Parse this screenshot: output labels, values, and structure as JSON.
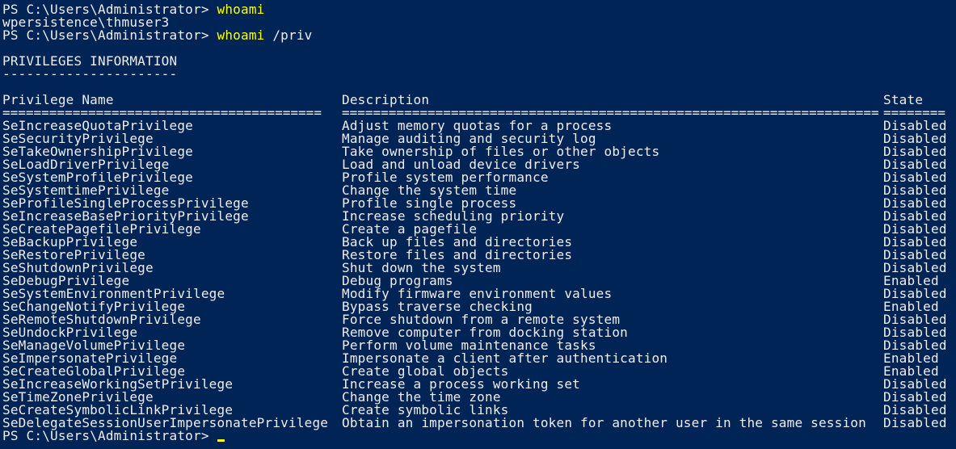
{
  "terminal": {
    "line1": {
      "prompt": "PS C:\\Users\\Administrator> ",
      "command": "whoami"
    },
    "output1": "wpersistence\\thmuser3",
    "line2": {
      "prompt": "PS C:\\Users\\Administrator> ",
      "command": "whoami",
      "args": " /priv"
    },
    "section_title": "PRIVILEGES INFORMATION",
    "section_underline": "----------------------",
    "headers": {
      "name": "Privilege Name",
      "description": "Description",
      "state": "State"
    },
    "separators": {
      "name": "=========================================",
      "description": "=====================================================================",
      "state": "========"
    },
    "rows": [
      {
        "name": "SeIncreaseQuotaPrivilege",
        "description": "Adjust memory quotas for a process",
        "state": "Disabled"
      },
      {
        "name": "SeSecurityPrivilege",
        "description": "Manage auditing and security log",
        "state": "Disabled"
      },
      {
        "name": "SeTakeOwnershipPrivilege",
        "description": "Take ownership of files or other objects",
        "state": "Disabled"
      },
      {
        "name": "SeLoadDriverPrivilege",
        "description": "Load and unload device drivers",
        "state": "Disabled"
      },
      {
        "name": "SeSystemProfilePrivilege",
        "description": "Profile system performance",
        "state": "Disabled"
      },
      {
        "name": "SeSystemtimePrivilege",
        "description": "Change the system time",
        "state": "Disabled"
      },
      {
        "name": "SeProfileSingleProcessPrivilege",
        "description": "Profile single process",
        "state": "Disabled"
      },
      {
        "name": "SeIncreaseBasePriorityPrivilege",
        "description": "Increase scheduling priority",
        "state": "Disabled"
      },
      {
        "name": "SeCreatePagefilePrivilege",
        "description": "Create a pagefile",
        "state": "Disabled"
      },
      {
        "name": "SeBackupPrivilege",
        "description": "Back up files and directories",
        "state": "Disabled"
      },
      {
        "name": "SeRestorePrivilege",
        "description": "Restore files and directories",
        "state": "Disabled"
      },
      {
        "name": "SeShutdownPrivilege",
        "description": "Shut down the system",
        "state": "Disabled"
      },
      {
        "name": "SeDebugPrivilege",
        "description": "Debug programs",
        "state": "Enabled"
      },
      {
        "name": "SeSystemEnvironmentPrivilege",
        "description": "Modify firmware environment values",
        "state": "Disabled"
      },
      {
        "name": "SeChangeNotifyPrivilege",
        "description": "Bypass traverse checking",
        "state": "Enabled"
      },
      {
        "name": "SeRemoteShutdownPrivilege",
        "description": "Force shutdown from a remote system",
        "state": "Disabled"
      },
      {
        "name": "SeUndockPrivilege",
        "description": "Remove computer from docking station",
        "state": "Disabled"
      },
      {
        "name": "SeManageVolumePrivilege",
        "description": "Perform volume maintenance tasks",
        "state": "Disabled"
      },
      {
        "name": "SeImpersonatePrivilege",
        "description": "Impersonate a client after authentication",
        "state": "Enabled"
      },
      {
        "name": "SeCreateGlobalPrivilege",
        "description": "Create global objects",
        "state": "Enabled"
      },
      {
        "name": "SeIncreaseWorkingSetPrivilege",
        "description": "Increase a process working set",
        "state": "Disabled"
      },
      {
        "name": "SeTimeZonePrivilege",
        "description": "Change the time zone",
        "state": "Disabled"
      },
      {
        "name": "SeCreateSymbolicLinkPrivilege",
        "description": "Create symbolic links",
        "state": "Disabled"
      },
      {
        "name": "SeDelegateSessionUserImpersonatePrivilege",
        "description": "Obtain an impersonation token for another user in the same session",
        "state": "Disabled"
      }
    ],
    "final_prompt": "PS C:\\Users\\Administrator> "
  },
  "colors": {
    "background": "#012456",
    "text": "#eeedf0",
    "command": "#ffff00"
  }
}
